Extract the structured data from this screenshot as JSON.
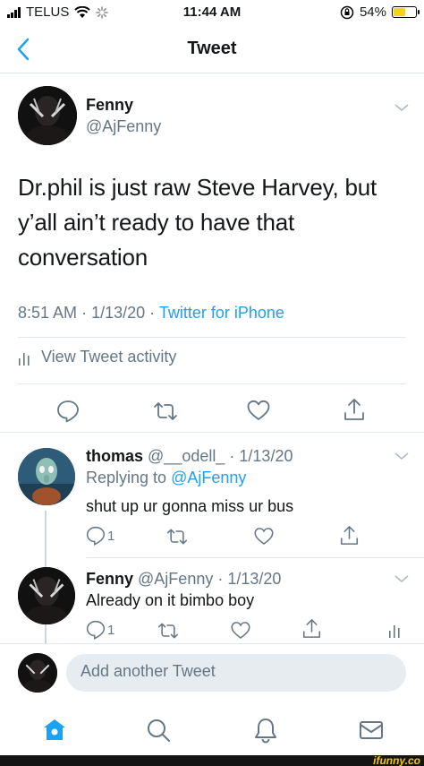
{
  "status_bar": {
    "carrier": "TELUS",
    "time": "11:44 AM",
    "battery_percent": "54%",
    "battery_level": 0.54,
    "icons": [
      "signal-icon",
      "wifi-icon",
      "loading-icon",
      "rotation-lock-icon",
      "battery-icon"
    ]
  },
  "header": {
    "title": "Tweet",
    "back_icon": "chevron-left-icon"
  },
  "main_tweet": {
    "author_name": "Fenny",
    "author_handle": "@AjFenny",
    "text_lines": [
      "Dr.phil is just raw Steve Harvey, but",
      "y’all ain’t ready to have that",
      "conversation"
    ],
    "time": "8:51 AM",
    "date": "1/13/20",
    "source": "Twitter for iPhone",
    "separator": "·",
    "activity_label": "View Tweet activity",
    "actions": [
      "reply-icon",
      "retweet-icon",
      "like-icon",
      "share-icon"
    ]
  },
  "replies": [
    {
      "author_name": "thomas",
      "author_handle": "@__odell_",
      "date": "1/13/20",
      "replying_prefix": "Replying to",
      "replying_to": "@AjFenny",
      "text": "shut up ur gonna miss ur bus",
      "reply_count": "1"
    },
    {
      "author_name": "Fenny",
      "author_handle": "@AjFenny",
      "date": "1/13/20",
      "text": "Already on it bimbo boy",
      "reply_count": "1"
    }
  ],
  "compose": {
    "placeholder": "Add another Tweet"
  },
  "tab_bar": {
    "tabs": [
      "home-icon",
      "search-icon",
      "notifications-icon",
      "messages-icon"
    ],
    "active_color": "#1da1f2"
  },
  "watermark": "ifunny.co",
  "colors": {
    "accent": "#1da1f2",
    "secondary_text": "#657786",
    "primary_text": "#14171a"
  }
}
